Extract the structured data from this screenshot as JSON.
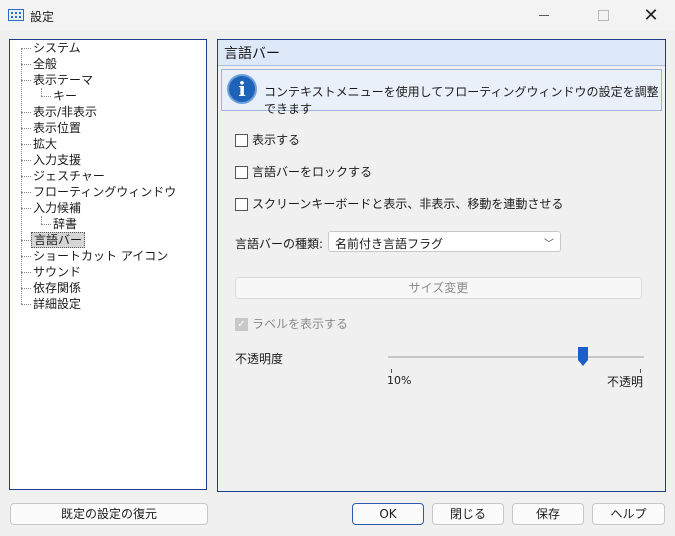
{
  "window": {
    "title": "設定"
  },
  "tree": {
    "items": [
      {
        "label": "システム"
      },
      {
        "label": "全般"
      },
      {
        "label": "表示テーマ"
      },
      {
        "label": "キー"
      },
      {
        "label": "表示/非表示"
      },
      {
        "label": "表示位置"
      },
      {
        "label": "拡大"
      },
      {
        "label": "入力支援"
      },
      {
        "label": "ジェスチャー"
      },
      {
        "label": "フローティングウィンドウ"
      },
      {
        "label": "入力候補"
      },
      {
        "label": "辞書"
      },
      {
        "label": "言語バー"
      },
      {
        "label": "ショートカット アイコン"
      },
      {
        "label": "サウンド"
      },
      {
        "label": "依存関係"
      },
      {
        "label": "詳細設定"
      }
    ],
    "selected": "言語バー"
  },
  "panel": {
    "title": "言語バー",
    "info": "コンテキストメニューを使用してフローティングウィンドウの設定を調整できます",
    "checkboxes": {
      "show": "表示する",
      "lock": "言語バーをロックする",
      "sync": "スクリーンキーボードと表示、非表示、移動を連動させる"
    },
    "type_label": "言語バーの種類:",
    "type_value": "名前付き言語フラグ",
    "resize_button": "サイズ変更",
    "show_labels": "ラベルを表示する",
    "show_labels_checked": true,
    "opacity_label": "不透明度",
    "opacity_min": "10%",
    "opacity_max": "不透明",
    "opacity_percent": 76
  },
  "buttons": {
    "restore": "既定の設定の復元",
    "ok": "OK",
    "close": "閉じる",
    "save": "保存",
    "help": "ヘルプ"
  },
  "colors": {
    "accent": "#1f63b8",
    "frame": "#1f3a8a",
    "thumb": "#1a5fc8"
  }
}
